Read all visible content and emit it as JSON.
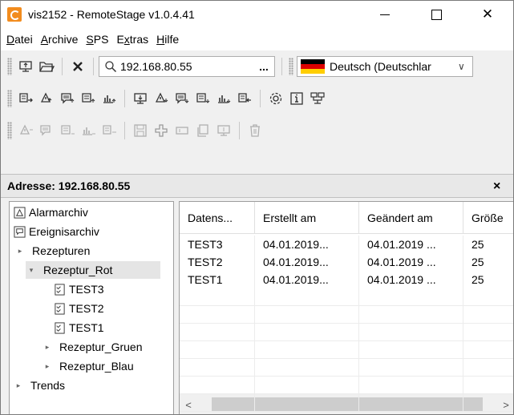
{
  "window": {
    "title": "vis2152 - RemoteStage v1.0.4.41"
  },
  "menu": {
    "items": [
      {
        "label": "Datei",
        "mnemonic_index": 0
      },
      {
        "label": "Archive",
        "mnemonic_index": 0
      },
      {
        "label": "SPS",
        "mnemonic_index": 0
      },
      {
        "label": "Extras",
        "mnemonic_index": 1
      },
      {
        "label": "Hilfe",
        "mnemonic_index": 0
      }
    ]
  },
  "toolbar": {
    "address_value": "192.168.80.55",
    "address_browse_label": "...",
    "language_value": "Deutsch (Deutschlar",
    "flag_colors": [
      "#000000",
      "#dd0000",
      "#ffce00"
    ]
  },
  "address_header": {
    "label": "Adresse: 192.168.80.55",
    "close_label": "×"
  },
  "tree": {
    "items": [
      {
        "label": "Alarmarchiv",
        "icon": "alarm-archive-icon",
        "expander": ""
      },
      {
        "label": "Ereignisarchiv",
        "icon": "event-archive-icon",
        "expander": ""
      },
      {
        "label": "Rezepturen",
        "icon": "",
        "expander": "▸"
      },
      {
        "label": "Rezeptur_Rot",
        "icon": "",
        "expander": "▾"
      },
      {
        "label": "TEST3",
        "icon": "recipe-file-icon",
        "expander": ""
      },
      {
        "label": "TEST2",
        "icon": "recipe-file-icon",
        "expander": ""
      },
      {
        "label": "TEST1",
        "icon": "recipe-file-icon",
        "expander": ""
      },
      {
        "label": "Rezeptur_Gruen",
        "icon": "",
        "expander": "▸"
      },
      {
        "label": "Rezeptur_Blau",
        "icon": "",
        "expander": "▸"
      },
      {
        "label": "Trends",
        "icon": "",
        "expander": "▸"
      }
    ]
  },
  "table": {
    "columns": [
      "Datens...",
      "Erstellt am",
      "Geändert am",
      "Größe"
    ],
    "rows": [
      [
        "TEST3",
        "04.01.2019...",
        "04.01.2019 ...",
        "25"
      ],
      [
        "TEST2",
        "04.01.2019...",
        "04.01.2019 ...",
        "25"
      ],
      [
        "TEST1",
        "04.01.2019...",
        "04.01.2019 ...",
        "25"
      ]
    ]
  },
  "scrollbar": {
    "left_arrow": "<",
    "right_arrow": ">"
  }
}
